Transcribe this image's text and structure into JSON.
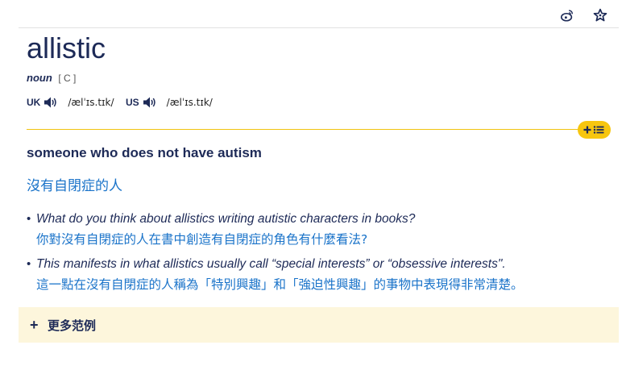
{
  "icons": {
    "weibo": "weibo-icon",
    "favorite": "star-icon",
    "speaker": "speaker-icon",
    "add_to_list": "plus-list-icon"
  },
  "entry": {
    "headword": "allistic",
    "pos": "noun",
    "grammar": "[ C ]",
    "pron_uk_label": "UK",
    "pron_uk_ipa": "/ælˈɪs.tɪk/",
    "pron_us_label": "US",
    "pron_us_ipa": "/ælˈɪs.tɪk/",
    "definition": "someone who does not have autism",
    "translation": "沒有自閉症的人",
    "examples": [
      {
        "en": "What do you think about allistics writing autistic characters in books?",
        "zh": "你對沒有自閉症的人在書中創造有自閉症的角色有什麼看法?"
      },
      {
        "en": "This manifests in what allistics usually call “special interests” or “obsessive interests\".",
        "zh": "這一點在沒有自閉症的人稱為「特別興趣」和「強迫性興趣」的事物中表現得非常清楚。"
      }
    ],
    "bullet": "•",
    "more_examples_label": "更多范例",
    "more_examples_icon": "+"
  },
  "colors": {
    "navy": "#1d2a57",
    "blue_translation": "#1a73c9",
    "accent_yellow": "#f7c60f",
    "more_bg": "#fdf6dc"
  }
}
